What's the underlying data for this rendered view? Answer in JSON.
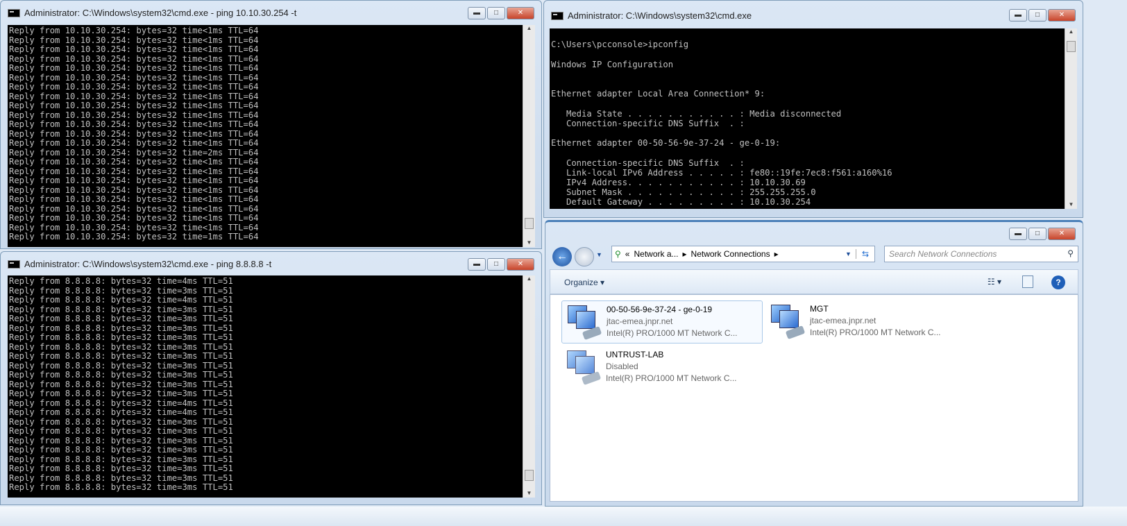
{
  "win_ping_gw": {
    "title": "Administrator: C:\\Windows\\system32\\cmd.exe - ping  10.10.30.254 -t",
    "target": "10.10.30.254",
    "bytes": "32",
    "ttl": "64",
    "times": [
      "<1ms",
      "<1ms",
      "<1ms",
      "<1ms",
      "<1ms",
      "<1ms",
      "<1ms",
      "<1ms",
      "<1ms",
      "<1ms",
      "<1ms",
      "<1ms",
      "<1ms",
      "=2ms",
      "<1ms",
      "<1ms",
      "<1ms",
      "<1ms",
      "<1ms",
      "<1ms",
      "<1ms",
      "<1ms",
      "=1ms"
    ]
  },
  "win_ping_dns": {
    "title": "Administrator: C:\\Windows\\system32\\cmd.exe - ping  8.8.8.8 -t",
    "target": "8.8.8.8",
    "bytes": "32",
    "ttl": "51",
    "times": [
      "=4ms",
      "=3ms",
      "=4ms",
      "=3ms",
      "=3ms",
      "=3ms",
      "=3ms",
      "=3ms",
      "=3ms",
      "=3ms",
      "=3ms",
      "=3ms",
      "=3ms",
      "=4ms",
      "=4ms",
      "=3ms",
      "=3ms",
      "=3ms",
      "=3ms",
      "=3ms",
      "=3ms",
      "=3ms",
      "=3ms"
    ]
  },
  "win_ipconfig": {
    "title": "Administrator: C:\\Windows\\system32\\cmd.exe",
    "lines": [
      "",
      "C:\\Users\\pcconsole>ipconfig",
      "",
      "Windows IP Configuration",
      "",
      "",
      "Ethernet adapter Local Area Connection* 9:",
      "",
      "   Media State . . . . . . . . . . . : Media disconnected",
      "   Connection-specific DNS Suffix  . :",
      "",
      "Ethernet adapter 00-50-56-9e-37-24 - ge-0-19:",
      "",
      "   Connection-specific DNS Suffix  . :",
      "   Link-local IPv6 Address . . . . . : fe80::19fe:7ec8:f561:a160%16",
      "   IPv4 Address. . . . . . . . . . . : 10.10.30.69",
      "   Subnet Mask . . . . . . . . . . . : 255.255.255.0",
      "   Default Gateway . . . . . . . . . : 10.10.30.254"
    ]
  },
  "explorer": {
    "breadcrumb": [
      "Network a...",
      "Network Connections"
    ],
    "search_placeholder": "Search Network Connections",
    "organize": "Organize",
    "items": [
      {
        "name": "00-50-56-9e-37-24 - ge-0-19",
        "status": "jtac-emea.jnpr.net",
        "device": "Intel(R) PRO/1000 MT Network C..."
      },
      {
        "name": "MGT",
        "status": "jtac-emea.jnpr.net",
        "device": "Intel(R) PRO/1000 MT Network C..."
      },
      {
        "name": "UNTRUST-LAB",
        "status": "Disabled",
        "device": "Intel(R) PRO/1000 MT Network C..."
      }
    ]
  }
}
